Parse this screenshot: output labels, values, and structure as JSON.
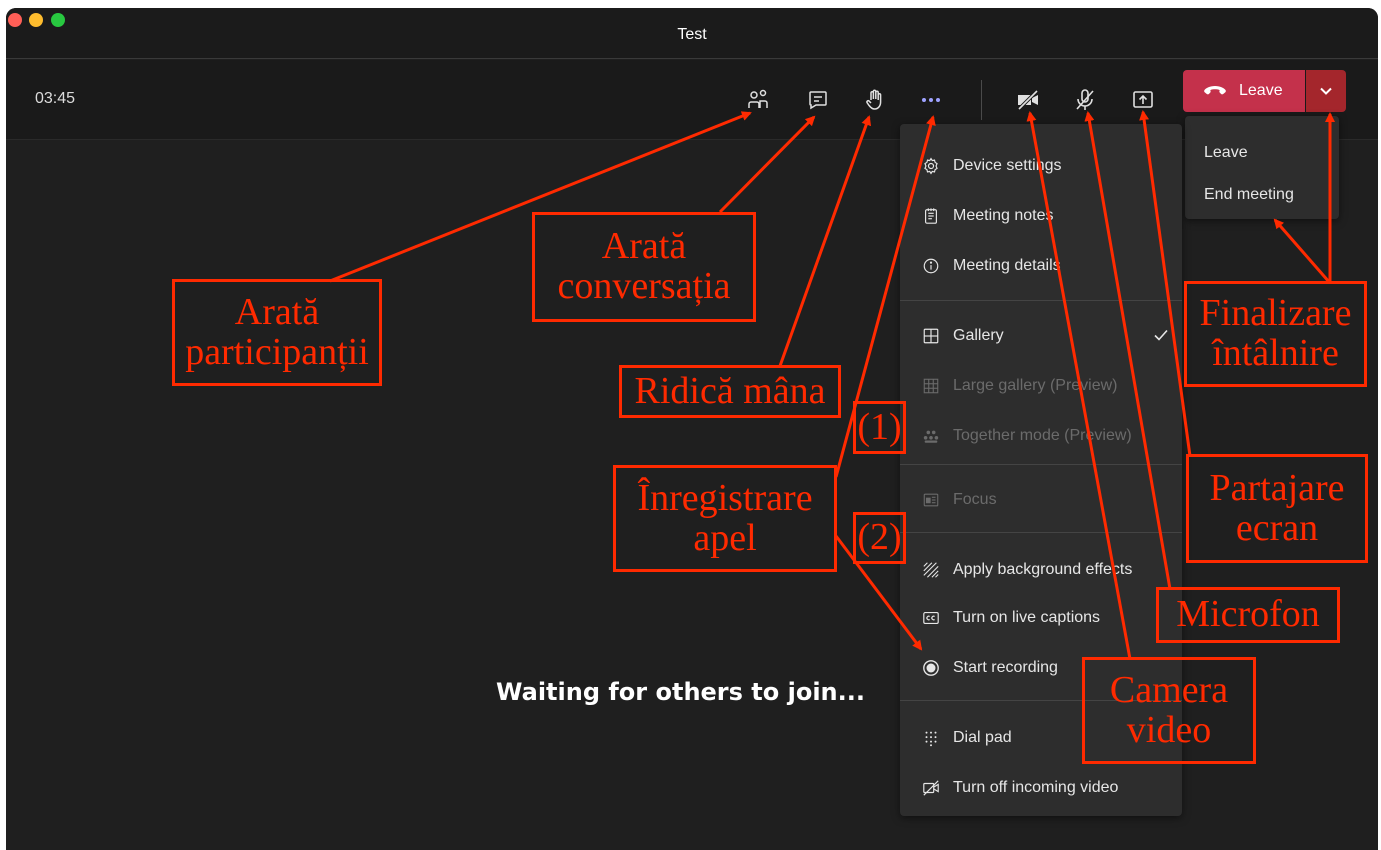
{
  "window": {
    "title": "Test"
  },
  "toolbar": {
    "timer": "03:45",
    "leave_label": "Leave"
  },
  "leave_menu": {
    "items": [
      "Leave",
      "End meeting"
    ]
  },
  "more_menu": {
    "items": [
      {
        "label": "Device settings",
        "icon": "gear-icon",
        "enabled": true
      },
      {
        "label": "Meeting notes",
        "icon": "notes-icon",
        "enabled": true
      },
      {
        "label": "Meeting details",
        "icon": "info-icon",
        "enabled": true
      },
      {
        "label": "Gallery",
        "icon": "gallery-icon",
        "enabled": true,
        "checked": true
      },
      {
        "label": "Large gallery (Preview)",
        "icon": "large-gallery-icon",
        "enabled": false
      },
      {
        "label": "Together mode (Preview)",
        "icon": "together-mode-icon",
        "enabled": false
      },
      {
        "label": "Focus",
        "icon": "focus-icon",
        "enabled": false
      },
      {
        "label": "Apply background effects",
        "icon": "background-effects-icon",
        "enabled": true
      },
      {
        "label": "Turn on live captions",
        "icon": "captions-icon",
        "enabled": true
      },
      {
        "label": "Start recording",
        "icon": "record-icon",
        "enabled": true
      },
      {
        "label": "Dial pad",
        "icon": "dialpad-icon",
        "enabled": true
      },
      {
        "label": "Turn off incoming video",
        "icon": "video-off-icon",
        "enabled": true
      }
    ]
  },
  "stage": {
    "message": "Waiting for others to join..."
  },
  "annotations": {
    "participants": [
      "Arată",
      "participanții"
    ],
    "chat": [
      "Arată",
      "conversația"
    ],
    "raise_hand": "Ridică mâna",
    "step1": "(1)",
    "step2": "(2)",
    "record": [
      "Înregistrare",
      "apel"
    ],
    "end_meeting": [
      "Finalizare",
      "întâlnire"
    ],
    "share": [
      "Partajare",
      "ecran"
    ],
    "mic": "Microfon",
    "camera": [
      "Camera",
      "video"
    ]
  },
  "colors": {
    "annotation": "#ff2a00",
    "leave": "#c4314b",
    "accent_underline": "#9ea2ff"
  }
}
